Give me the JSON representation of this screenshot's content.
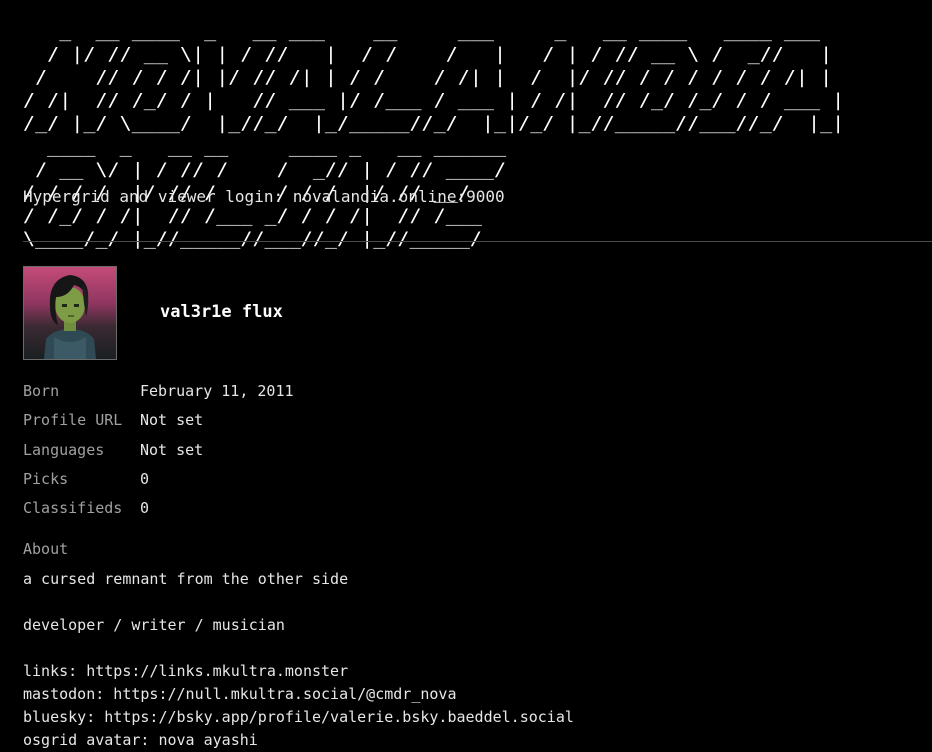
{
  "site": {
    "logo_ascii": "   _  __ ____  _   __ ___    __     ___     _   __ ____   ____ ___ \n  / |/ // __ \\| | / //   |  / /    /   |   / | / // __ \\ /  _//   |\n /    // / / /| |/ // /| | / /    / /| |  /  |/ // / / / / / / /| |\n/ /|  // /_/ / |   // ___ |/ /___ / ___ | / /|  // /_/ /_/ / / ___ |\n/_/ |_/ \\____/  |_//_/  |_/_____//_/  |_|/_/ |_//_____//___//_/  |_|\n  ____  _   __ __     ____ _   __ ______\n / __ \\/ | / // /    /  _// | / // ____/\n/ / / /  |/ // /     / / /  |/ // __/   \n/ /_/ / /|  // /___ _/ / / /|  // /___   \n\\____/_/ |_//_____//___//_/ |_//_____/   ",
    "login_text": "Hypergrid and viewer login: novalandia.online:9000"
  },
  "profile": {
    "name": "val3r1e flux",
    "avatar_alt": "avatar-image",
    "fields": [
      {
        "label": "Born",
        "value": "February 11, 2011"
      },
      {
        "label": "Profile URL",
        "value": "Not set"
      },
      {
        "label": "Languages",
        "value": "Not set"
      },
      {
        "label": "Picks",
        "value": "0"
      },
      {
        "label": "Classifieds",
        "value": "0"
      }
    ],
    "about_label": "About",
    "about_text": "a cursed remnant from the other side\n\ndeveloper / writer / musician\n\nlinks: https://links.mkultra.monster\nmastodon: https://null.mkultra.social/@cmdr_nova\nbluesky: https://bsky.app/profile/valerie.bsky.baeddel.social\nosgrid avatar: nova ayashi"
  },
  "colors": {
    "background": "#000000",
    "text": "#e6e6e6",
    "label": "#a0a0a0",
    "divider": "#4a4a4a"
  }
}
